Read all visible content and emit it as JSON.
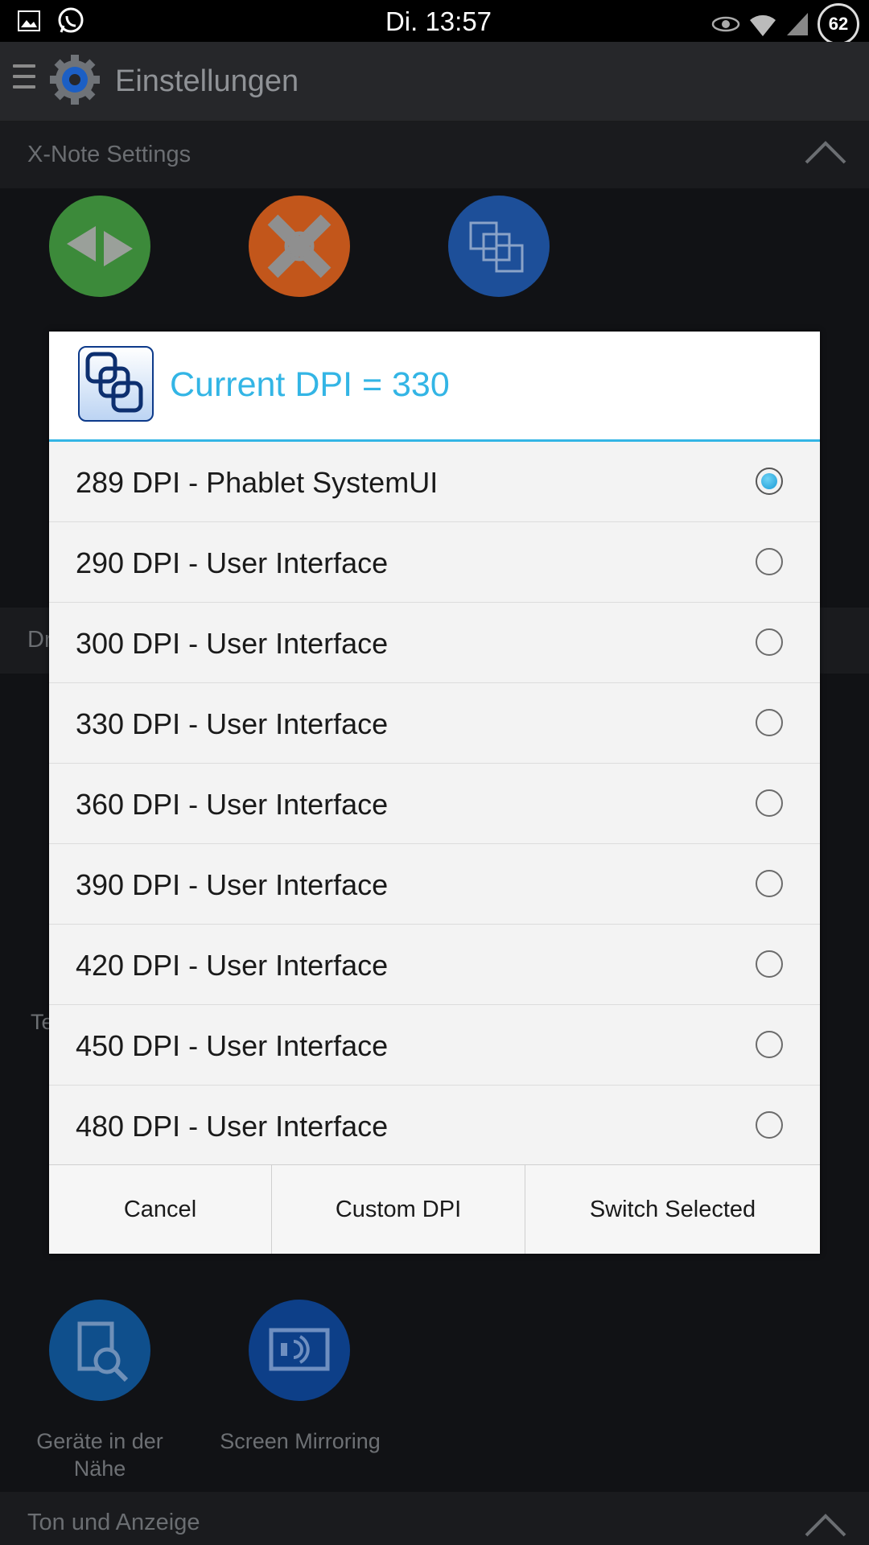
{
  "status_bar": {
    "time": "Di. 13:57",
    "battery": "62"
  },
  "app_bar": {
    "title": "Einstellungen"
  },
  "background": {
    "section_xnote": "X-Note Settings",
    "section_dr": "Dr",
    "partial_te": "Te",
    "nearby_devices_label": "Geräte in der Nähe",
    "screen_mirroring_label": "Screen Mirroring",
    "section_sound": "Ton und Anzeige"
  },
  "dialog": {
    "title": "Current DPI = 330",
    "options": [
      {
        "label": "289 DPI - Phablet SystemUI",
        "selected": true
      },
      {
        "label": "290 DPI - User Interface",
        "selected": false
      },
      {
        "label": "300 DPI - User Interface",
        "selected": false
      },
      {
        "label": "330 DPI - User Interface",
        "selected": false
      },
      {
        "label": "360 DPI - User Interface",
        "selected": false
      },
      {
        "label": "390 DPI - User Interface",
        "selected": false
      },
      {
        "label": "420 DPI - User Interface",
        "selected": false
      },
      {
        "label": "450 DPI - User Interface",
        "selected": false
      },
      {
        "label": "480 DPI - User Interface",
        "selected": false
      }
    ],
    "buttons": {
      "cancel": "Cancel",
      "custom": "Custom DPI",
      "switch": "Switch Selected"
    }
  },
  "colors": {
    "accent": "#33b5e5",
    "status_bar": "#000000",
    "app_bar": "#26272a"
  }
}
